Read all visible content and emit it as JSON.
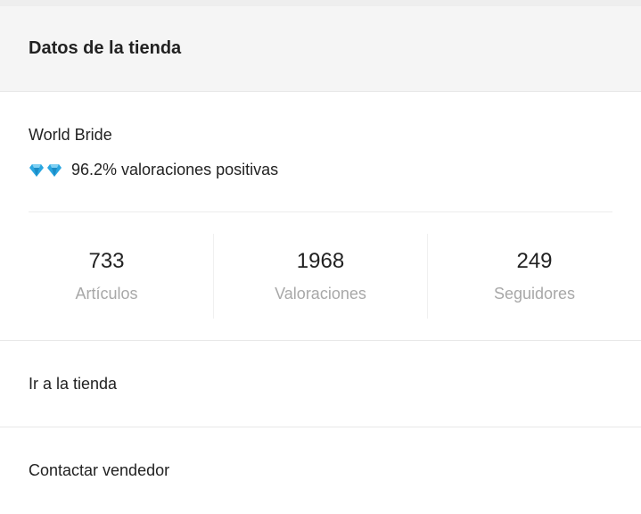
{
  "header": {
    "title": "Datos de la tienda"
  },
  "store": {
    "name": "World Bride",
    "rating_text": "96.2% valoraciones positivas",
    "rating_icons": [
      "diamond-icon",
      "diamond-icon"
    ],
    "diamond_color": "#2aa6e0"
  },
  "stats": [
    {
      "value": "733",
      "label": "Artículos"
    },
    {
      "value": "1968",
      "label": "Valoraciones"
    },
    {
      "value": "249",
      "label": "Seguidores"
    }
  ],
  "links": {
    "go_to_store": "Ir a la tienda",
    "contact_seller": "Contactar vendedor"
  }
}
